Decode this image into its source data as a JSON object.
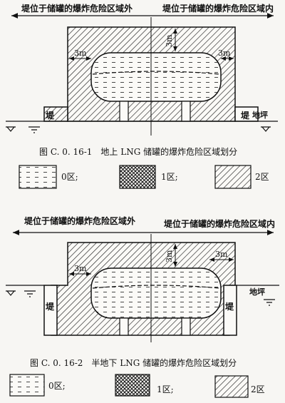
{
  "figure1": {
    "label_outside": "堤位于储罐的爆炸危险区域外",
    "label_inside": "堤位于储罐的爆炸危险区域内",
    "dim_top": "3m",
    "dim_left": "3m",
    "dim_right": "3m",
    "dike_left": "堤",
    "dike_right": "堤",
    "ground": "地坪",
    "caption": "图 C. 0. 16-1　地上 LNG 储罐的爆炸危险区域划分"
  },
  "figure2": {
    "label_outside": "堤位于储罐的爆炸危险区域外",
    "label_inside": "堤位于储罐的爆炸危险区域内",
    "dim_top": "3m",
    "dim_left": "3m",
    "dim_right": "3m",
    "dike_left": "堤",
    "dike_right": "堤",
    "ground": "地坪",
    "caption": "图 C. 0. 16-2　半地下 LNG 储罐的爆炸危险区域划分"
  },
  "legend1": {
    "zone0": "0区;",
    "zone1": "1区;",
    "zone2": "2区"
  },
  "legend2": {
    "zone0": "0区;",
    "zone1": "1区;",
    "zone2": "2区"
  }
}
